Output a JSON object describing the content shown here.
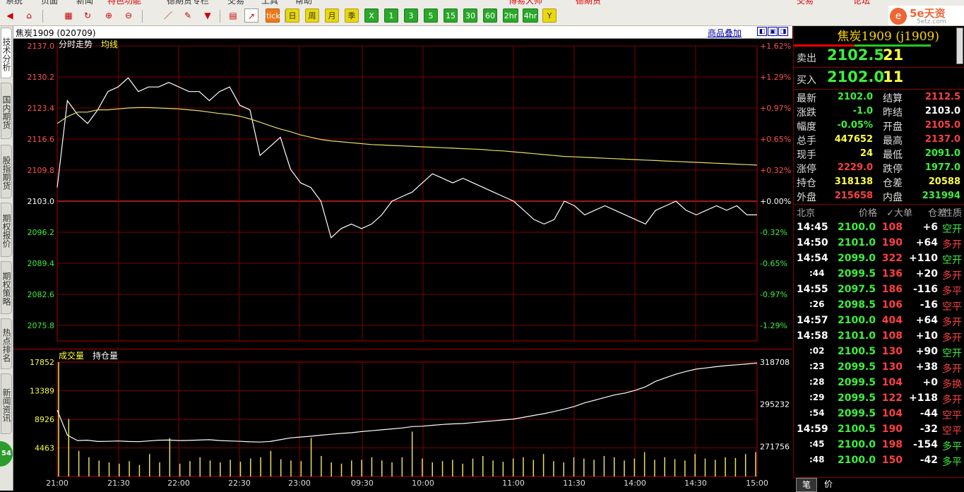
{
  "menu": [
    "系统",
    "页面",
    "新闻",
    "特色功能",
    "德期贷专栏",
    "交易",
    "工具",
    "帮助"
  ],
  "menu_right": [
    "博易大师",
    "德期货"
  ],
  "menu_buttons": [
    "交易",
    "论坛"
  ],
  "toolbar": {
    "icons": [
      "back-arrow-icon",
      "home-icon",
      "chart-icon",
      "refresh-icon",
      "zoom-in-icon",
      "zoom-out-icon",
      "line-draw-icon",
      "pencil-icon",
      "filter-icon",
      "table-view-icon",
      "intraday-chart-icon"
    ],
    "period_buttons": [
      "tick",
      "日",
      "周",
      "月",
      "季",
      "X",
      "1",
      "3",
      "5",
      "15",
      "30",
      "60",
      "2hr",
      "4hr",
      "Y"
    ]
  },
  "brand": {
    "logo_text": "5e天资",
    "url": "5etz.com"
  },
  "sidebar_tabs": [
    "技术分析",
    "国内期货",
    "股指期货",
    "期权报价",
    "期权策略",
    "热点排名",
    "新闻资讯"
  ],
  "sidebar_badge": "54",
  "chart_header": {
    "symbol": "焦炭1909 (020709)",
    "overlay_button": "商品叠加"
  },
  "chart_data": [
    {
      "type": "line",
      "legend": [
        "分时走势",
        "均线"
      ],
      "y_ticks": [
        "2137.0",
        "2130.2",
        "2123.4",
        "2116.6",
        "2109.8",
        "2103.0",
        "2096.2",
        "2089.4",
        "2082.6",
        "2075.8"
      ],
      "pct_ticks": [
        "+1.62%",
        "+1.29%",
        "+0.97%",
        "+0.65%",
        "+0.32%",
        "+0.00%",
        "-0.32%",
        "-0.65%",
        "-0.97%",
        "-1.29%"
      ],
      "ylim": [
        2072.4,
        2137.0
      ],
      "prev_settle": 2103.0,
      "x": [
        0,
        5,
        10,
        15,
        20,
        25,
        30,
        35,
        40,
        45,
        50,
        55,
        60,
        65,
        70,
        75,
        80,
        85,
        90,
        95,
        100,
        105,
        110,
        115,
        120,
        125,
        130,
        135,
        140,
        145,
        150,
        155,
        160,
        165,
        170,
        175,
        180,
        185,
        190,
        195,
        200,
        205,
        210,
        215,
        220,
        225,
        230,
        235,
        240,
        245,
        250,
        255,
        260,
        265,
        270,
        275,
        280,
        285,
        290,
        295,
        300,
        305,
        310,
        315,
        320,
        325,
        330,
        335,
        340,
        345
      ],
      "series": [
        {
          "name": "分时走势",
          "values": [
            2106,
            2125,
            2122,
            2120,
            2123,
            2127,
            2128,
            2130,
            2127,
            2128,
            2128,
            2129,
            2128,
            2127,
            2127,
            2125,
            2127,
            2128,
            2124,
            2123,
            2113,
            2115,
            2117,
            2110,
            2107,
            2106,
            2103,
            2095,
            2097,
            2098,
            2097,
            2098,
            2100,
            2103,
            2104,
            2105,
            2107,
            2109,
            2108,
            2107,
            2108,
            2107,
            2106,
            2105,
            2104,
            2103,
            2101,
            2099,
            2098,
            2099,
            2103,
            2102,
            2100,
            2101,
            2102,
            2101,
            2100,
            2099,
            2098,
            2101,
            2102,
            2103,
            2101,
            2100,
            2101,
            2102,
            2101,
            2102,
            2100,
            2100
          ]
        },
        {
          "name": "均线",
          "values": [
            2120,
            2121.5,
            2122.5,
            2122.5,
            2123,
            2123,
            2123.2,
            2123.4,
            2123.5,
            2123.5,
            2123.4,
            2123.3,
            2123.2,
            2123,
            2122.8,
            2122.5,
            2122.2,
            2122,
            2121.6,
            2121,
            2120.3,
            2119.5,
            2118.8,
            2118.2,
            2117.5,
            2117,
            2116.5,
            2116.2,
            2116,
            2115.8,
            2115.6,
            2115.4,
            2115.3,
            2115.2,
            2115.1,
            2115,
            2114.9,
            2114.8,
            2114.7,
            2114.6,
            2114.5,
            2114.4,
            2114.3,
            2114.1,
            2114,
            2113.8,
            2113.6,
            2113.4,
            2113.2,
            2113,
            2112.8,
            2112.7,
            2112.6,
            2112.5,
            2112.4,
            2112.3,
            2112.2,
            2112.1,
            2112,
            2111.9,
            2111.8,
            2111.7,
            2111.6,
            2111.5,
            2111.4,
            2111.3,
            2111.2,
            2111.1,
            2111.0,
            2110.9
          ]
        }
      ]
    },
    {
      "type": "bar",
      "legend": [
        "成交量",
        "持仓量"
      ],
      "vol_ticks": [
        "17852",
        "13389",
        "8926",
        "4463"
      ],
      "oi_ticks": [
        "318708",
        "295232",
        "271756"
      ],
      "vol_ylim": [
        0,
        17852
      ],
      "oi_ylim": [
        255000,
        318708
      ],
      "x_ticks": [
        "21:00",
        "21:30",
        "22:00",
        "22:30",
        "23:00",
        "09:30",
        "10:00",
        "11:00",
        "11:30",
        "14:00",
        "14:30",
        "15:00"
      ],
      "volume": [
        17852,
        9000,
        4000,
        3000,
        2500,
        2200,
        2000,
        2400,
        1800,
        3500,
        2200,
        6000,
        2000,
        2400,
        3000,
        2500,
        2200,
        2600,
        2300,
        2800,
        3000,
        4000,
        2700,
        2500,
        2400,
        6000,
        3200,
        2200,
        2000,
        2500,
        2600,
        3000,
        2500,
        2200,
        3000,
        7000,
        2800,
        2200,
        2400,
        2600,
        2000,
        2800,
        3200,
        2500,
        2300,
        2800,
        3000,
        2600,
        3500,
        2400,
        2200,
        3000,
        2800,
        2600,
        3200,
        3000,
        2500,
        2800,
        3800,
        2600,
        3000,
        2700,
        2500,
        3500,
        2800,
        2600,
        3000,
        2900,
        3500,
        3800
      ],
      "open_interest": [
        292000,
        278000,
        275000,
        275200,
        274500,
        274600,
        274800,
        274500,
        274400,
        274800,
        275200,
        275300,
        275000,
        275100,
        275300,
        275500,
        275000,
        274800,
        274600,
        274300,
        274200,
        274500,
        275500,
        276500,
        277000,
        277400,
        278000,
        278500,
        279000,
        279400,
        280000,
        280500,
        281000,
        281500,
        282000,
        282800,
        283000,
        283500,
        284000,
        284300,
        284500,
        285000,
        285500,
        286000,
        286500,
        287000,
        288000,
        289000,
        290000,
        291200,
        292500,
        294000,
        296000,
        297500,
        299000,
        300500,
        301500,
        303000,
        305000,
        308000,
        310000,
        312000,
        313500,
        314800,
        315500,
        316200,
        316800,
        317200,
        317700,
        318200
      ]
    }
  ],
  "quote": {
    "name": "焦炭1909 (j1909)",
    "sell_label": "卖出",
    "sell_price": "2102.5",
    "sell_qty": "21",
    "buy_label": "买入",
    "buy_price": "2102.0",
    "buy_qty": "11",
    "rows": [
      {
        "l1": "最新",
        "v1": "2102.0",
        "c1": "green",
        "l2": "结算",
        "v2": "2112.5",
        "c2": "red"
      },
      {
        "l1": "涨跌",
        "v1": "-1.0",
        "c1": "green",
        "l2": "昨结",
        "v2": "2103.0",
        "c2": "white"
      },
      {
        "l1": "幅度",
        "v1": "-0.05%",
        "c1": "green",
        "l2": "开盘",
        "v2": "2105.0",
        "c2": "red"
      },
      {
        "l1": "总手",
        "v1": "447652",
        "c1": "yellow",
        "l2": "最高",
        "v2": "2137.0",
        "c2": "red"
      },
      {
        "l1": "现手",
        "v1": "24",
        "c1": "yellow",
        "l2": "最低",
        "v2": "2091.0",
        "c2": "green"
      },
      {
        "l1": "涨停",
        "v1": "2229.0",
        "c1": "red",
        "l2": "跌停",
        "v2": "1977.0",
        "c2": "green"
      },
      {
        "l1": "持仓",
        "v1": "318138",
        "c1": "yellow",
        "l2": "仓差",
        "v2": "20588",
        "c2": "yellow"
      },
      {
        "l1": "外盘",
        "v1": "215658",
        "c1": "red",
        "l2": "内盘",
        "v2": "231994",
        "c2": "green"
      }
    ]
  },
  "ticks": {
    "headers": [
      "北京",
      "价格",
      "✓大单",
      "仓差",
      "性质"
    ],
    "rows": [
      {
        "time": "14:45",
        "price": "2100.0",
        "vol": "108",
        "oi": "+6",
        "nature": "空开",
        "nc": "green"
      },
      {
        "time": "14:50",
        "price": "2101.0",
        "vol": "190",
        "oi": "+64",
        "nature": "多开",
        "nc": "red"
      },
      {
        "time": "14:54",
        "price": "2099.0",
        "vol": "322",
        "oi": "+110",
        "nature": "空开",
        "nc": "green"
      },
      {
        "time": ":44",
        "price": "2099.5",
        "vol": "136",
        "oi": "+20",
        "nature": "多开",
        "nc": "red"
      },
      {
        "time": "14:55",
        "price": "2097.5",
        "vol": "186",
        "oi": "-116",
        "nature": "多平",
        "nc": "red"
      },
      {
        "time": ":26",
        "price": "2098.5",
        "vol": "106",
        "oi": "-16",
        "nature": "空平",
        "nc": "red"
      },
      {
        "time": "14:57",
        "price": "2100.0",
        "vol": "404",
        "oi": "+64",
        "nature": "多开",
        "nc": "red"
      },
      {
        "time": "14:58",
        "price": "2101.0",
        "vol": "108",
        "oi": "+10",
        "nature": "多开",
        "nc": "red"
      },
      {
        "time": ":02",
        "price": "2100.5",
        "vol": "130",
        "oi": "+90",
        "nature": "空开",
        "nc": "green"
      },
      {
        "time": ":23",
        "price": "2099.5",
        "vol": "130",
        "oi": "+38",
        "nature": "多开",
        "nc": "red"
      },
      {
        "time": ":28",
        "price": "2099.5",
        "vol": "104",
        "oi": "+0",
        "nature": "多换",
        "nc": "red"
      },
      {
        "time": ":29",
        "price": "2099.5",
        "vol": "122",
        "oi": "+118",
        "nature": "多开",
        "nc": "red"
      },
      {
        "time": ":54",
        "price": "2099.5",
        "vol": "104",
        "oi": "-44",
        "nature": "空平",
        "nc": "red"
      },
      {
        "time": "14:59",
        "price": "2100.5",
        "vol": "190",
        "oi": "-32",
        "nature": "空平",
        "nc": "red"
      },
      {
        "time": ":45",
        "price": "2100.0",
        "vol": "198",
        "oi": "-154",
        "nature": "多平",
        "nc": "green"
      },
      {
        "time": ":48",
        "price": "2100.0",
        "vol": "150",
        "oi": "-42",
        "nature": "多平",
        "nc": "green"
      }
    ]
  },
  "bottom_tabs": [
    "笔",
    "价"
  ]
}
